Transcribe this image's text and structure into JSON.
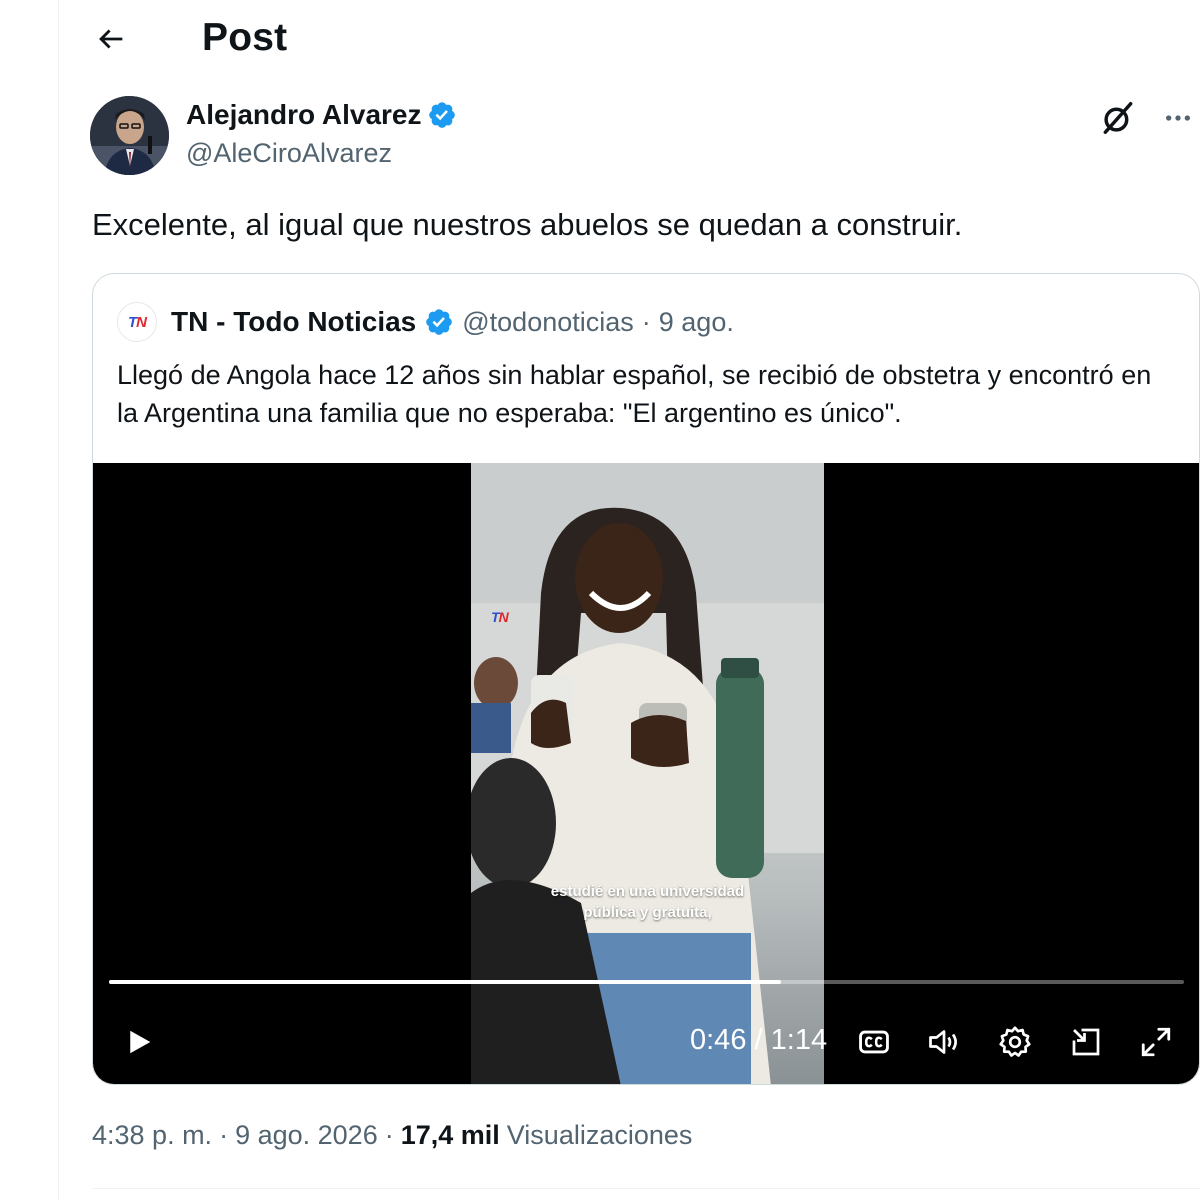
{
  "header": {
    "title": "Post",
    "back_icon": "arrow-left-icon"
  },
  "author": {
    "name": "Alejandro Alvarez",
    "handle": "@AleCiroAlvarez",
    "verified": true
  },
  "tweet": {
    "text": "Excelente, al igual que nuestros abuelos se quedan a construir."
  },
  "quote": {
    "logo_t": "T",
    "logo_n": "N",
    "name": "TN - Todo Noticias",
    "handle": "@todonoticias",
    "separator": "·",
    "date": "9 ago.",
    "text": "Llegó de Angola hace 12 años sin hablar español, se recibió de obstetra y encontró en la Argentina una familia que no esperaba: \"El argentino es único\".",
    "video": {
      "logo_t": "T",
      "logo_n": "N",
      "caption_line1": "estudié en una universidad",
      "caption_line2": "pública y gratuita,",
      "current_time": "0:46",
      "time_separator": "/",
      "duration": "1:14",
      "progress": 0.625
    }
  },
  "meta": {
    "time": "4:38 p. m.",
    "separator1": "·",
    "date": "9 ago. 2026",
    "separator2": "·",
    "views_count": "17,4 mil",
    "views_label": "Visualizaciones"
  },
  "colors": {
    "verified_blue": "#1d9bf0",
    "secondary_text": "#536471",
    "border": "#cfd9de"
  }
}
